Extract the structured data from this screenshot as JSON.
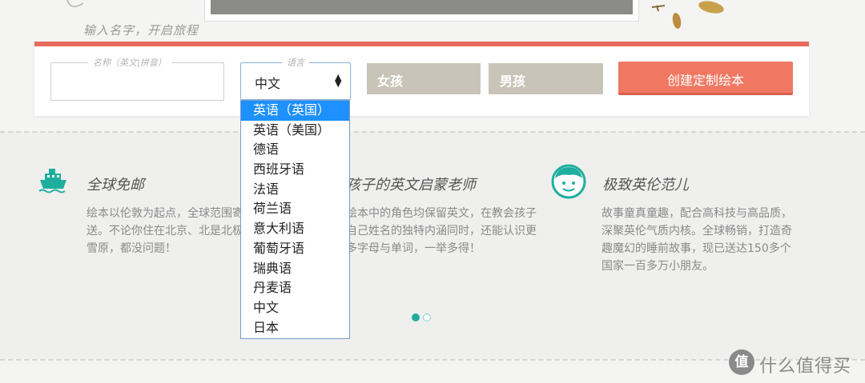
{
  "hero": {
    "subtitle": "输入名字，开启旅程"
  },
  "form": {
    "name_legend": "名称（英文|拼音）",
    "name_value": "",
    "language_legend": "语言",
    "language_selected": "中文",
    "girl_label": "女孩",
    "boy_label": "男孩",
    "create_label": "创建定制绘本",
    "accent_color": "#e86a5c"
  },
  "dropdown": {
    "options": [
      "英语（英国）",
      "英语（美国）",
      "德语",
      "西班牙语",
      "法语",
      "荷兰语",
      "意大利语",
      "葡萄牙语",
      "瑞典语",
      "丹麦语",
      "中文",
      "日本"
    ],
    "highlighted": "英语（英国）"
  },
  "features": [
    {
      "icon": "ship-icon",
      "title": "全球免邮",
      "text": "绘本以伦敦为起点，全球范围寄送。不论你住在北京、北是北极雪原，都没问题！"
    },
    {
      "icon": "book-icon",
      "title": "孩子的英文启蒙老师",
      "text": "绘本中的角色均保留英文，在教会孩子自己姓名的独特内涵同时，还能认识更多字母与单词，一举多得！"
    },
    {
      "icon": "face-icon",
      "title": "极致英伦范儿",
      "text": "故事童真童趣，配合高科技与高品质，深聚英伦气质内核。全球畅销，打造奇趣魔幻的睡前故事，现已送达150多个国家一百多万小朋友。"
    }
  ],
  "carousel": {
    "active_index": 0,
    "count": 2
  },
  "watermark": {
    "logo": "值",
    "text": "什么值得买"
  }
}
